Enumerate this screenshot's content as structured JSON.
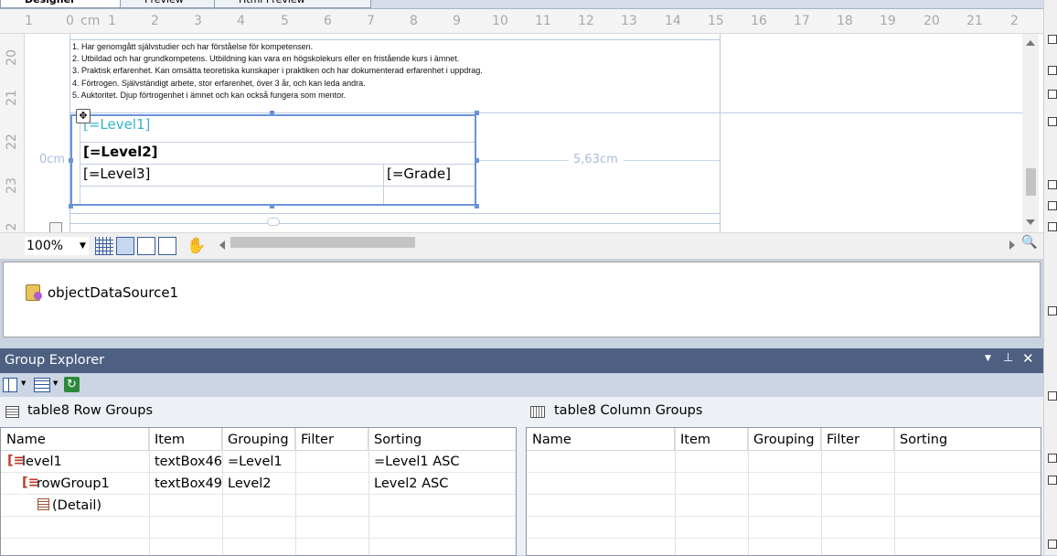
{
  "designer_tabs": [
    "Designer",
    "Preview",
    "Html Preview"
  ],
  "ruler": {
    "unit": "cm",
    "h_numbers": [
      "1",
      "0",
      "cm",
      "1",
      "2",
      "3",
      "4",
      "5",
      "6",
      "7",
      "8",
      "9",
      "10",
      "11",
      "12",
      "13",
      "14",
      "15",
      "16",
      "17",
      "18",
      "19",
      "20",
      "21",
      "2"
    ],
    "v_numbers": [
      "20",
      "21",
      "22",
      "23",
      "2"
    ]
  },
  "report_body": {
    "description_lines": [
      "1. Har genomgått självstudier och har förståelse för kompetensen.",
      "2. Utbildad och har grundkompetens. Utbildning kan vara en högskolekurs eller en fristående kurs i ämnet.",
      "3. Praktisk erfarenhet. Kan omsätta teoretiska kunskaper i praktiken och har dokumenterad erfarenhet i uppdrag.",
      "4. Förtrogen. Självständigt arbete, stor erfarenhet, över 3 år, och kan leda andra.",
      "5. Auktoritet. Djup förtrogenhet i ämnet och kan också fungera som mentor."
    ],
    "table": {
      "level1": "[=Level1]",
      "level2": "[=Level2]",
      "level3": "[=Level3]",
      "grade": "[=Grade]"
    },
    "measure_left": "0cm",
    "measure_right": "5,63cm"
  },
  "designer_toolbar": {
    "zoom": "100%"
  },
  "component_tray": {
    "items": [
      "objectDataSource1"
    ]
  },
  "group_explorer": {
    "title": "Group Explorer",
    "row_groups": {
      "title": "table8 Row Groups",
      "columns": [
        "Name",
        "Item",
        "Grouping",
        "Filter",
        "Sorting"
      ],
      "rows": [
        {
          "name": "level1",
          "item": "textBox46",
          "grouping": "=Level1",
          "filter": "",
          "sorting": "=Level1 ASC"
        },
        {
          "name": "rowGroup1",
          "item": "textBox49",
          "grouping": "Level2",
          "filter": "",
          "sorting": "Level2 ASC"
        },
        {
          "name": "(Detail)",
          "item": "",
          "grouping": "",
          "filter": "",
          "sorting": ""
        }
      ]
    },
    "column_groups": {
      "title": "table8 Column Groups",
      "columns": [
        "Name",
        "Item",
        "Grouping",
        "Filter",
        "Sorting"
      ],
      "rows": []
    }
  },
  "colors": {
    "accent": "#6b93d8",
    "tool_window_title": "#4d6082",
    "level1_text": "#36b3c8"
  }
}
